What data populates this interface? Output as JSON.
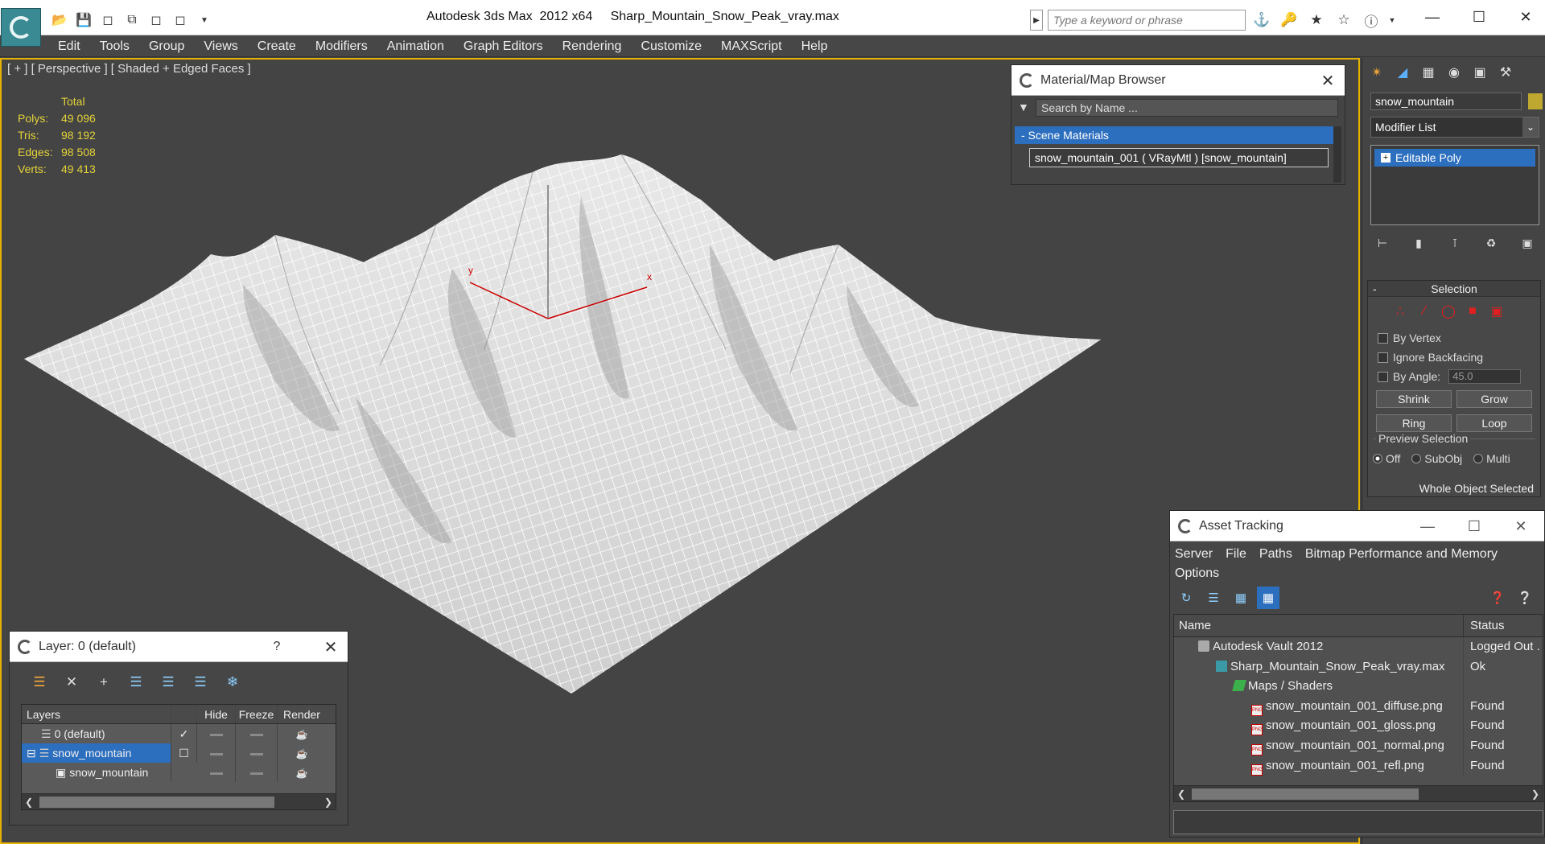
{
  "window": {
    "title": "Autodesk 3ds Max  2012 x64     Sharp_Mountain_Snow_Peak_vray.max",
    "search_placeholder": "Type a keyword or phrase"
  },
  "menu": [
    "Edit",
    "Tools",
    "Group",
    "Views",
    "Create",
    "Modifiers",
    "Animation",
    "Graph Editors",
    "Rendering",
    "Customize",
    "MAXScript",
    "Help"
  ],
  "viewport": {
    "label": "[ + ] [ Perspective ] [ Shaded + Edged Faces ]",
    "stats_header": "Total",
    "stats": [
      {
        "k": "Polys:",
        "v": "49 096"
      },
      {
        "k": "Tris:",
        "v": "98 192"
      },
      {
        "k": "Edges:",
        "v": "98 508"
      },
      {
        "k": "Verts:",
        "v": "49 413"
      }
    ],
    "axis_x": "x",
    "axis_y": "y"
  },
  "material_browser": {
    "title": "Material/Map Browser",
    "search_placeholder": "Search by Name ...",
    "section": "- Scene Materials",
    "item": "snow_mountain_001  ( VRayMtl )  [snow_mountain]"
  },
  "command_panel": {
    "object_name": "snow_mountain",
    "object_color": "#bfa830",
    "modifier_list": "Modifier List",
    "stack_item": "Editable Poly",
    "selection": {
      "title": "Selection",
      "by_vertex": "By Vertex",
      "ignore_backfacing": "Ignore Backfacing",
      "by_angle": "By Angle:",
      "angle_value": "45.0",
      "shrink": "Shrink",
      "grow": "Grow",
      "ring": "Ring",
      "loop": "Loop",
      "preview_label": "Preview Selection",
      "off": "Off",
      "subobj": "SubObj",
      "multi": "Multi",
      "status": "Whole Object Selected"
    }
  },
  "layer_dialog": {
    "title": "Layer: 0 (default)",
    "help": "?",
    "columns": [
      "Layers",
      "Hide",
      "Freeze",
      "Render"
    ],
    "rows": [
      {
        "name": "0 (default)",
        "current": "✓"
      },
      {
        "name": "snow_mountain",
        "current": ""
      },
      {
        "name": "snow_mountain",
        "current": ""
      }
    ]
  },
  "asset_tracking": {
    "title": "Asset Tracking",
    "menu": [
      "Server",
      "File",
      "Paths",
      "Bitmap Performance and Memory",
      "Options"
    ],
    "columns": [
      "Name",
      "Status"
    ],
    "rows": [
      {
        "name": "Autodesk Vault 2012",
        "status": "Logged Out ."
      },
      {
        "name": "Sharp_Mountain_Snow_Peak_vray.max",
        "status": "Ok"
      },
      {
        "name": "Maps / Shaders",
        "status": ""
      },
      {
        "name": "snow_mountain_001_diffuse.png",
        "status": "Found"
      },
      {
        "name": "snow_mountain_001_gloss.png",
        "status": "Found"
      },
      {
        "name": "snow_mountain_001_normal.png",
        "status": "Found"
      },
      {
        "name": "snow_mountain_001_refl.png",
        "status": "Found"
      }
    ]
  }
}
